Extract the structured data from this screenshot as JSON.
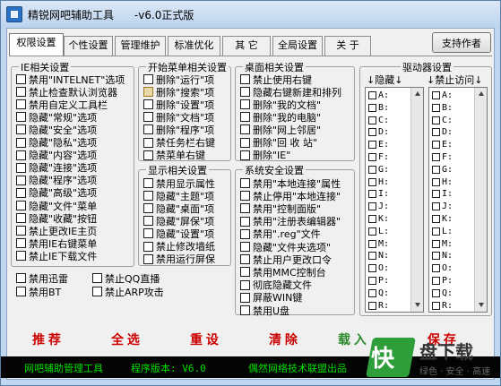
{
  "window": {
    "title": "精锐网吧辅助工具      -v6.0正式版"
  },
  "tabs": [
    "权限设置",
    "个性设置",
    "管理维护",
    "标准优化",
    "其 它",
    "全局设置",
    "关 于"
  ],
  "support_button": "支持作者",
  "ie_group": {
    "title": "IE相关设置",
    "items": [
      "禁用\"INTELNET\"选项",
      "禁止检查默认浏览器",
      "禁用自定义工具栏",
      "隐藏\"常规\"选项",
      "隐藏\"安全\"选项",
      "隐藏\"隐私\"选项",
      "隐藏\"内容\"选项",
      "隐藏\"连接\"选项",
      "隐藏\"程序\"选项",
      "隐藏\"高级\"选项",
      "隐藏\"文件\"菜单",
      "隐藏\"收藏\"按钮",
      "禁止更改IE主页",
      "禁用IE右键菜单",
      "禁止IE下载文件"
    ]
  },
  "start_group": {
    "title": "开始菜单相关设置",
    "items": [
      "删除\"运行\"项",
      "删除\"搜索\"项",
      "删除\"设置\"项",
      "删除\"文档\"项",
      "删除\"程序\"项",
      "禁任务栏右键",
      "禁菜单右键"
    ],
    "checked_index": 1
  },
  "display_group": {
    "title": "显示相关设置",
    "items": [
      "禁用显示属性",
      "隐藏\"主题\"项",
      "隐藏\"桌面\"项",
      "隐藏\"屏保\"项",
      "隐藏\"设置\"项",
      "禁止修改墙纸",
      "禁用运行屏保"
    ]
  },
  "desktop_group": {
    "title": "桌面相关设置",
    "items": [
      "禁止使用右键",
      "隐藏右键新建和排列",
      "删除\"我的文档\"",
      "删除\"我的电脑\"",
      "删除\"网上邻居\"",
      "删除\"回 收 站\"",
      "删除\"IE\""
    ]
  },
  "security_group": {
    "title": "系统安全设置",
    "items": [
      "禁用\"本地连接\"属性",
      "禁止停用\"本地连接\"",
      "禁用\"控制面版\"",
      "禁用\"注册表编辑器\"",
      "禁用\".reg\"文件",
      "隐藏\"文件夹选项\"",
      "禁止用户更改口令",
      "禁用MMC控制台",
      "彻底隐藏文件",
      "屏蔽WIN键",
      "禁用U盘"
    ]
  },
  "misc_items": [
    "禁用迅雷",
    "禁止QQ直播",
    "禁用BT",
    "禁止ARP攻击"
  ],
  "drives": {
    "title": "驱动器设置",
    "hide_label": "↓隐藏↓",
    "deny_label": "↓禁止访问↓",
    "letters": [
      "A:",
      "B:",
      "C:",
      "D:",
      "E:",
      "F:",
      "G:",
      "H:",
      "I:",
      "J:",
      "K:",
      "L:",
      "M:",
      "N:",
      "O:",
      "P:",
      "Q:",
      "R:"
    ]
  },
  "buttons": [
    "推 荐",
    "全 选",
    "重 设",
    "清 除",
    "载 入",
    "保 存"
  ],
  "statusbar": {
    "left": "网吧辅助管理工具",
    "version": "程序版本: V6.0",
    "right": "偶然网络技术联盟出品"
  },
  "watermark": {
    "logo": "快",
    "title": "盘下载",
    "subtitle": "绿色 · 安全 · 高速"
  }
}
